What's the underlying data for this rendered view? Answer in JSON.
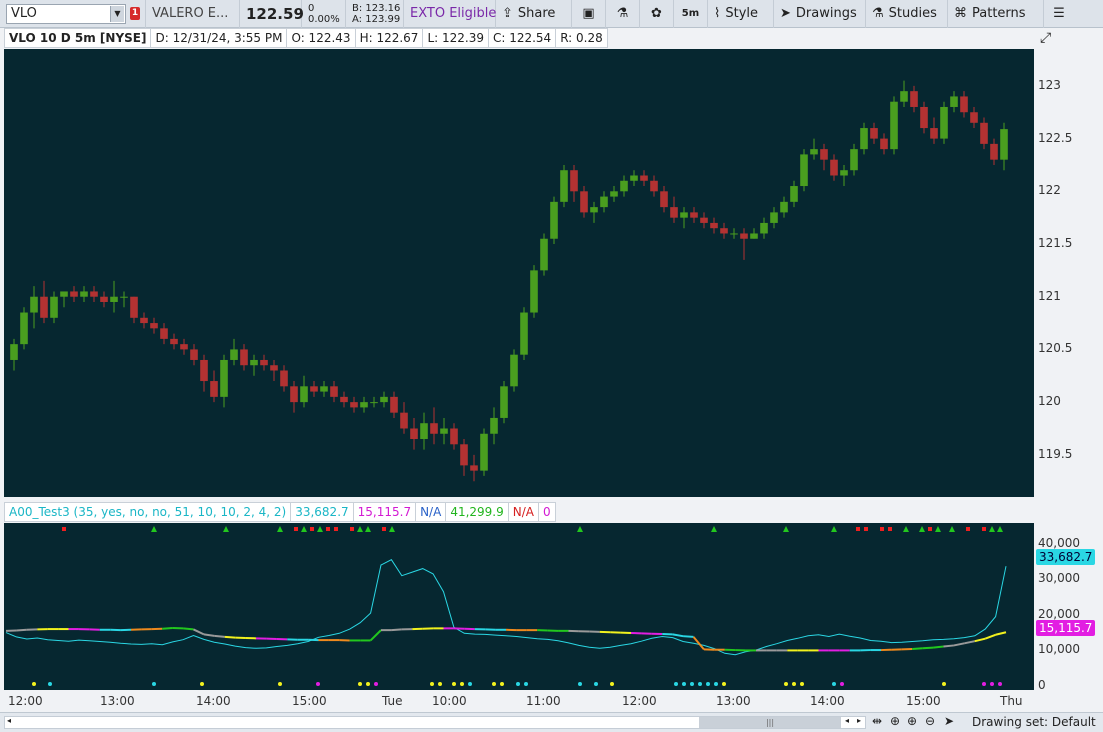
{
  "toolbar": {
    "symbol": "VLO",
    "alert_count": "1",
    "company": "VALERO E...",
    "last_price": "122.59",
    "change": "0",
    "change_pct": "0.00%",
    "bid": "B: 123.16",
    "ask": "A: 123.99",
    "exto": "EXTO Eligible",
    "share_label": "Share",
    "timeframe": "5m",
    "style_label": "Style",
    "drawings_label": "Drawings",
    "studies_label": "Studies",
    "patterns_label": "Patterns"
  },
  "infobar": {
    "title": "VLO 10 D 5m [NYSE]",
    "date": "D: 12/31/24, 3:55 PM",
    "open": "O: 122.43",
    "high": "H: 122.67",
    "low": "L: 122.39",
    "close": "C: 122.54",
    "range": "R: 0.28"
  },
  "indicator": {
    "name": "A00_Test3 (35, yes, no, no, 51, 10, 10, 2, 4, 2)",
    "v1": "33,682.7",
    "v2": "15,115.7",
    "v3": "N/A",
    "v4": "41,299.9",
    "v5": "N/A",
    "v6": "0",
    "label_cyan": "33,682.7",
    "label_magenta": "15,115.7"
  },
  "colors": {
    "bg": "#062730",
    "up": "#4a9e1f",
    "down": "#b33232",
    "cyan": "#2ad7e4",
    "magenta": "#e21ee2",
    "gray": "#9a9a9a",
    "yellow": "#f2f21e",
    "orange": "#ee8a1e",
    "green": "#22c71e",
    "red": "#ee2020"
  },
  "price_axis": [
    "123",
    "122.5",
    "122",
    "121.5",
    "121",
    "120.5",
    "120",
    "119.5"
  ],
  "sub_axis": [
    "40,000",
    "30,000",
    "20,000",
    "10,000",
    "0"
  ],
  "time_axis": [
    "12:00",
    "13:00",
    "14:00",
    "15:00",
    "Tue",
    "10:00",
    "11:00",
    "12:00",
    "13:00",
    "14:00",
    "15:00",
    "Thu"
  ],
  "bottom": {
    "drawing_set": "Drawing set: Default"
  },
  "chart_data": {
    "type": "candlestick",
    "ylim": [
      119.1,
      123.35
    ],
    "candles": [
      [
        120.4,
        120.6,
        120.3,
        120.55
      ],
      [
        120.55,
        120.9,
        120.5,
        120.85
      ],
      [
        120.85,
        121.1,
        120.7,
        121.0
      ],
      [
        121.0,
        121.15,
        120.75,
        120.8
      ],
      [
        120.8,
        121.05,
        120.75,
        121.0
      ],
      [
        121.0,
        121.05,
        120.9,
        121.05
      ],
      [
        121.05,
        121.1,
        120.95,
        121.0
      ],
      [
        121.0,
        121.1,
        120.95,
        121.05
      ],
      [
        121.05,
        121.1,
        120.95,
        121.0
      ],
      [
        121.0,
        121.05,
        120.9,
        120.95
      ],
      [
        120.95,
        121.15,
        120.85,
        121.0
      ],
      [
        121.0,
        121.05,
        120.9,
        121.0
      ],
      [
        121.0,
        121.0,
        120.75,
        120.8
      ],
      [
        120.8,
        120.85,
        120.7,
        120.75
      ],
      [
        120.75,
        120.8,
        120.65,
        120.7
      ],
      [
        120.7,
        120.75,
        120.55,
        120.6
      ],
      [
        120.6,
        120.65,
        120.5,
        120.55
      ],
      [
        120.55,
        120.6,
        120.45,
        120.5
      ],
      [
        120.5,
        120.55,
        120.35,
        120.4
      ],
      [
        120.4,
        120.45,
        120.1,
        120.2
      ],
      [
        120.2,
        120.3,
        120.0,
        120.05
      ],
      [
        120.05,
        120.45,
        119.95,
        120.4
      ],
      [
        120.4,
        120.6,
        120.35,
        120.5
      ],
      [
        120.5,
        120.55,
        120.3,
        120.35
      ],
      [
        120.35,
        120.45,
        120.25,
        120.4
      ],
      [
        120.4,
        120.45,
        120.3,
        120.35
      ],
      [
        120.35,
        120.4,
        120.2,
        120.3
      ],
      [
        120.3,
        120.35,
        120.1,
        120.15
      ],
      [
        120.15,
        120.2,
        119.9,
        120.0
      ],
      [
        120.0,
        120.25,
        119.95,
        120.15
      ],
      [
        120.15,
        120.2,
        120.05,
        120.1
      ],
      [
        120.1,
        120.2,
        120.05,
        120.15
      ],
      [
        120.15,
        120.2,
        120.0,
        120.05
      ],
      [
        120.05,
        120.1,
        119.95,
        120.0
      ],
      [
        120.0,
        120.05,
        119.9,
        119.95
      ],
      [
        119.95,
        120.05,
        119.9,
        120.0
      ],
      [
        120.0,
        120.05,
        119.95,
        120.0
      ],
      [
        120.0,
        120.1,
        119.95,
        120.05
      ],
      [
        120.05,
        120.1,
        119.85,
        119.9
      ],
      [
        119.9,
        120.0,
        119.7,
        119.75
      ],
      [
        119.75,
        119.85,
        119.55,
        119.65
      ],
      [
        119.65,
        119.9,
        119.55,
        119.8
      ],
      [
        119.8,
        119.95,
        119.6,
        119.7
      ],
      [
        119.7,
        119.85,
        119.6,
        119.75
      ],
      [
        119.75,
        119.8,
        119.55,
        119.6
      ],
      [
        119.6,
        119.65,
        119.3,
        119.4
      ],
      [
        119.4,
        119.5,
        119.25,
        119.35
      ],
      [
        119.35,
        119.75,
        119.3,
        119.7
      ],
      [
        119.7,
        119.95,
        119.6,
        119.85
      ],
      [
        119.85,
        120.2,
        119.8,
        120.15
      ],
      [
        120.15,
        120.5,
        120.1,
        120.45
      ],
      [
        120.45,
        120.9,
        120.4,
        120.85
      ],
      [
        120.85,
        121.3,
        120.8,
        121.25
      ],
      [
        121.25,
        121.6,
        121.2,
        121.55
      ],
      [
        121.55,
        121.95,
        121.5,
        121.9
      ],
      [
        121.9,
        122.25,
        121.85,
        122.2
      ],
      [
        122.2,
        122.25,
        121.9,
        122.0
      ],
      [
        122.0,
        122.05,
        121.75,
        121.8
      ],
      [
        121.8,
        121.9,
        121.7,
        121.85
      ],
      [
        121.85,
        122.0,
        121.8,
        121.95
      ],
      [
        121.95,
        122.05,
        121.9,
        122.0
      ],
      [
        122.0,
        122.15,
        121.95,
        122.1
      ],
      [
        122.1,
        122.2,
        122.05,
        122.15
      ],
      [
        122.15,
        122.2,
        122.05,
        122.1
      ],
      [
        122.1,
        122.15,
        121.95,
        122.0
      ],
      [
        122.0,
        122.05,
        121.8,
        121.85
      ],
      [
        121.85,
        121.95,
        121.7,
        121.75
      ],
      [
        121.75,
        121.85,
        121.65,
        121.8
      ],
      [
        121.8,
        121.85,
        121.7,
        121.75
      ],
      [
        121.75,
        121.8,
        121.65,
        121.7
      ],
      [
        121.7,
        121.75,
        121.6,
        121.65
      ],
      [
        121.65,
        121.7,
        121.55,
        121.6
      ],
      [
        121.6,
        121.65,
        121.55,
        121.6
      ],
      [
        121.6,
        121.65,
        121.35,
        121.55
      ],
      [
        121.55,
        121.65,
        121.55,
        121.6
      ],
      [
        121.6,
        121.75,
        121.55,
        121.7
      ],
      [
        121.7,
        121.85,
        121.65,
        121.8
      ],
      [
        121.8,
        121.95,
        121.75,
        121.9
      ],
      [
        121.9,
        122.1,
        121.85,
        122.05
      ],
      [
        122.05,
        122.4,
        122.0,
        122.35
      ],
      [
        122.35,
        122.5,
        122.3,
        122.4
      ],
      [
        122.4,
        122.45,
        122.2,
        122.3
      ],
      [
        122.3,
        122.35,
        122.1,
        122.15
      ],
      [
        122.15,
        122.25,
        122.05,
        122.2
      ],
      [
        122.2,
        122.45,
        122.15,
        122.4
      ],
      [
        122.4,
        122.65,
        122.35,
        122.6
      ],
      [
        122.6,
        122.65,
        122.45,
        122.5
      ],
      [
        122.5,
        122.55,
        122.35,
        122.4
      ],
      [
        122.4,
        122.9,
        122.35,
        122.85
      ],
      [
        122.85,
        123.05,
        122.8,
        122.95
      ],
      [
        122.95,
        123.0,
        122.75,
        122.8
      ],
      [
        122.8,
        122.85,
        122.55,
        122.6
      ],
      [
        122.6,
        122.7,
        122.45,
        122.5
      ],
      [
        122.5,
        122.85,
        122.45,
        122.8
      ],
      [
        122.8,
        122.95,
        122.75,
        122.9
      ],
      [
        122.9,
        122.95,
        122.7,
        122.75
      ],
      [
        122.75,
        122.8,
        122.6,
        122.65
      ],
      [
        122.65,
        122.7,
        122.4,
        122.45
      ],
      [
        122.45,
        122.5,
        122.25,
        122.3
      ],
      [
        122.3,
        122.65,
        122.2,
        122.59
      ]
    ],
    "sub_series": {
      "cyan": [
        15000,
        13800,
        13200,
        13500,
        13000,
        12800,
        12600,
        12900,
        12700,
        12500,
        12300,
        12000,
        11800,
        11700,
        11900,
        11600,
        12400,
        13000,
        14200,
        13100,
        12300,
        11800,
        11200,
        10800,
        10600,
        10700,
        11100,
        11400,
        11900,
        12500,
        13700,
        14200,
        14800,
        16000,
        17800,
        20500,
        34000,
        35500,
        31000,
        32000,
        33000,
        31500,
        26500,
        16500,
        14800,
        14600,
        14500,
        14300,
        14100,
        13900,
        13600,
        13300,
        13100,
        12700,
        12100,
        11400,
        10900,
        10600,
        10900,
        11400,
        11900,
        12600,
        13400,
        13900,
        13600,
        12500,
        12000,
        11400,
        10500,
        9200,
        8800,
        9600,
        10100,
        11100,
        11900,
        12800,
        13400,
        14100,
        14400,
        13900,
        14600,
        14000,
        13500,
        12800,
        12600,
        12200,
        12300,
        12500,
        12700,
        13000,
        13100,
        13300,
        13600,
        14100,
        16000,
        19500,
        33682
      ],
      "base": [
        15500,
        15600,
        15800,
        15900,
        16000,
        16000,
        16000,
        16000,
        15900,
        15800,
        15800,
        15700,
        15800,
        15900,
        16000,
        16100,
        16300,
        16200,
        15900,
        14500,
        14100,
        13800,
        13600,
        13500,
        13400,
        13300,
        13200,
        13100,
        13000,
        13000,
        12900,
        12900,
        12900,
        12800,
        12800,
        12800,
        15700,
        15700,
        15900,
        16000,
        16100,
        16200,
        16200,
        16200,
        16100,
        16000,
        15900,
        15800,
        15800,
        15700,
        15700,
        15700,
        15600,
        15500,
        15500,
        15400,
        15300,
        15200,
        15100,
        15000,
        14900,
        14800,
        14700,
        14600,
        14500,
        14000,
        13800,
        10300,
        10200,
        10200,
        10100,
        10000,
        10000,
        10000,
        10000,
        10000,
        10000,
        10000,
        10000,
        10000,
        10000,
        10000,
        10000,
        10100,
        10100,
        10200,
        10300,
        10400,
        10600,
        10800,
        11100,
        11400,
        12000,
        12600,
        13300,
        14400,
        15115
      ]
    }
  }
}
